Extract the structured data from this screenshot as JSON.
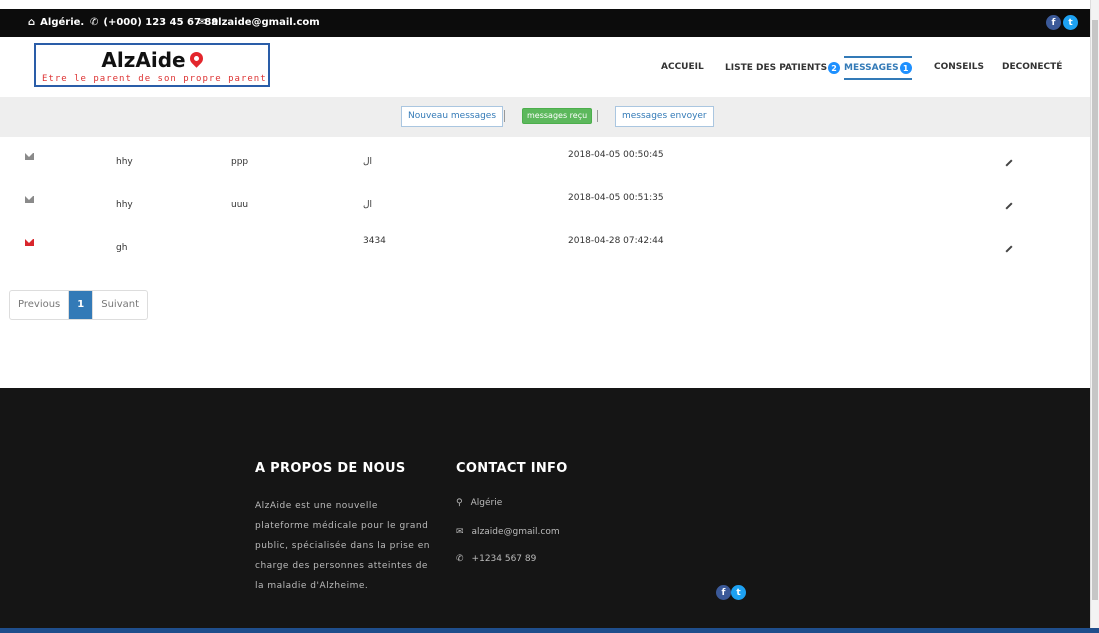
{
  "topbar": {
    "location": "Algérie.",
    "phone": "(+000) 123 45 67 89",
    "email": "alzaide@gmail.com",
    "facebook": "f",
    "twitter": "t"
  },
  "logo": {
    "brand": "AlzAide",
    "tagline": "Etre le parent de son propre parent"
  },
  "nav": {
    "accueil": "ACCUEIL",
    "patients": "LISTE DES PATIENTS",
    "patients_badge": "2",
    "messages": "MESSAGES",
    "messages_badge": "1",
    "conseils": "CONSEILS",
    "deconnect": "DECONECTÉ"
  },
  "subnav": {
    "new": "Nouveau messages",
    "received": "messages reçu",
    "sent": "messages envoyer"
  },
  "messages": [
    {
      "from": "hhy",
      "subject": "ppp",
      "body": "ال",
      "date": "2018-04-05 00:50:45",
      "read": true
    },
    {
      "from": "hhy",
      "subject": "uuu",
      "body": "ال",
      "date": "2018-04-05 00:51:35",
      "read": true
    },
    {
      "from": "gh",
      "subject": "",
      "body": "3434",
      "date": "2018-04-28 07:42:44",
      "read": false
    }
  ],
  "pagination": {
    "previous": "Previous",
    "current": "1",
    "next": "Suivant"
  },
  "footer": {
    "about_title": "A PROPOS DE NOUS",
    "about_text": "AlzAide est une nouvelle plateforme médicale pour le grand public, spécialisée dans la prise en charge des personnes atteintes de la maladie d'Alzheime.",
    "contact_title": "CONTACT INFO",
    "contact_location": "Algérie",
    "contact_email": "alzaide@gmail.com",
    "contact_phone": "+1234 567 89"
  },
  "colors": {
    "accent": "#337ab7",
    "badge": "#1e90ff",
    "success": "#5cb85c",
    "unread": "#d9262c"
  }
}
